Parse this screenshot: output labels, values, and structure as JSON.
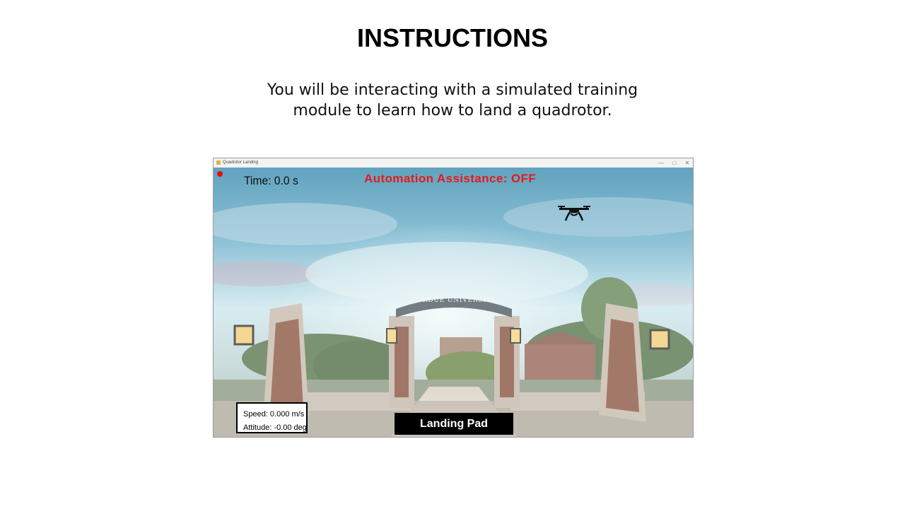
{
  "slide": {
    "title": "INSTRUCTIONS",
    "line1": "You will be interacting with a simulated training",
    "line2": "module to learn how to land a quadrotor."
  },
  "window": {
    "title": "Quadrotor Landing",
    "minimize_glyph": "—",
    "maximize_glyph": "□",
    "close_glyph": "✕"
  },
  "hud": {
    "time": "Time: 0.0 s",
    "automation": "Automation Assistance: OFF",
    "speed": "Speed: 0.000 m/s",
    "attitude": "Attitude: -0.00 deg",
    "landing_pad": "Landing Pad",
    "arch_sign": "PURDUE UNIVERSITY"
  },
  "colors": {
    "automation_text": "#e51a1a",
    "record_dot": "#e01010",
    "landing_pad_bg": "#000000"
  },
  "icons": {
    "drone": "quadrotor-icon",
    "record": "record-dot-icon"
  }
}
